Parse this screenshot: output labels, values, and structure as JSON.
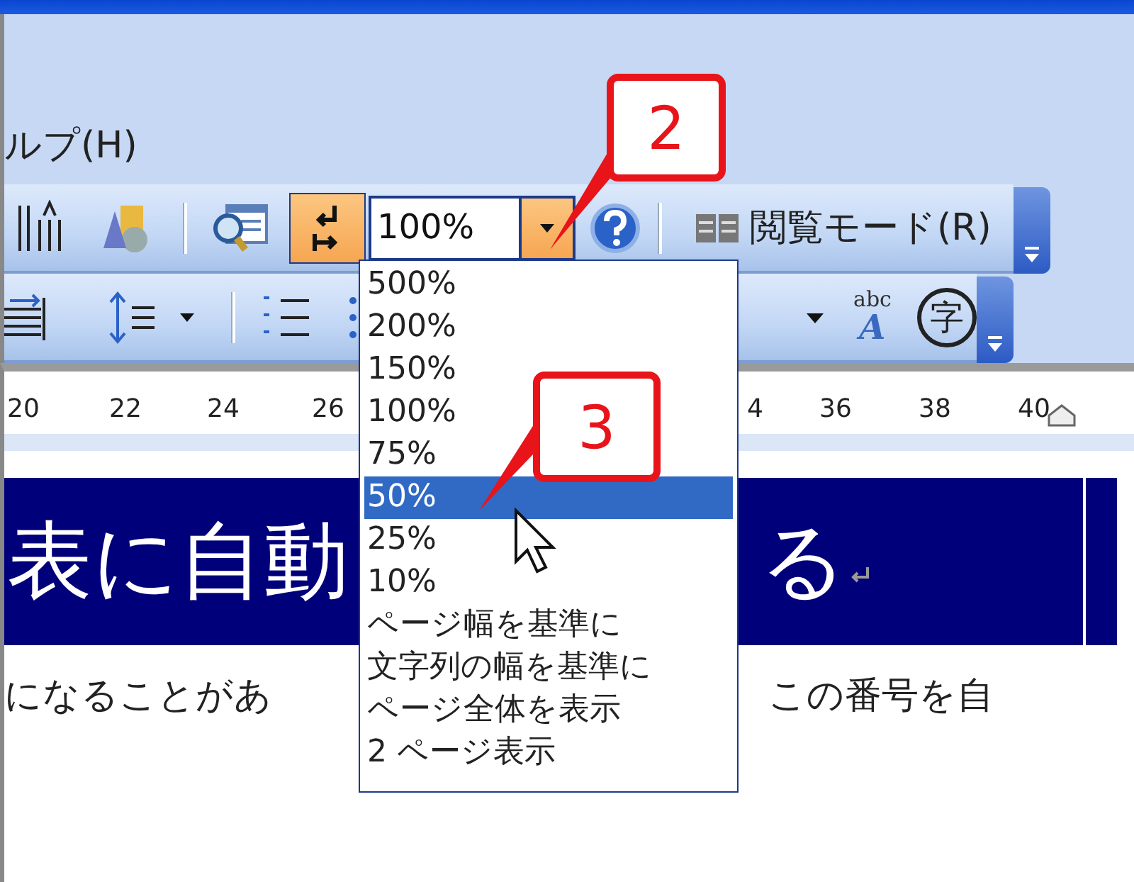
{
  "menu": {
    "label": "ルプ(H)"
  },
  "toolbar": {
    "marks_button_pressed": true,
    "zoom_value": "100%",
    "reading_mode": "閲覧モード(R)"
  },
  "format_toolbar": {
    "abc": "abc",
    "a": "A",
    "ruby": "字"
  },
  "ruler": {
    "ticks": [
      "20",
      "22",
      "24",
      "26",
      "4",
      "36",
      "38",
      "40"
    ]
  },
  "zoom_menu": {
    "items": [
      {
        "label": "500%",
        "selected": false
      },
      {
        "label": "200%",
        "selected": false
      },
      {
        "label": "150%",
        "selected": false
      },
      {
        "label": "100%",
        "selected": false
      },
      {
        "label": "75%",
        "selected": false
      },
      {
        "label": "50%",
        "selected": true
      },
      {
        "label": "25%",
        "selected": false
      },
      {
        "label": "10%",
        "selected": false
      },
      {
        "label": "ページ幅を基準に",
        "selected": false
      },
      {
        "label": "文字列の幅を基準に",
        "selected": false
      },
      {
        "label": "ページ全体を表示",
        "selected": false
      },
      {
        "label": "2 ページ表示",
        "selected": false
      }
    ]
  },
  "document": {
    "heading_left": "表に自動",
    "heading_right": "る",
    "paragraph_left": "になることがあ",
    "paragraph_right": "この番号を自"
  },
  "callouts": [
    "2",
    "3"
  ]
}
